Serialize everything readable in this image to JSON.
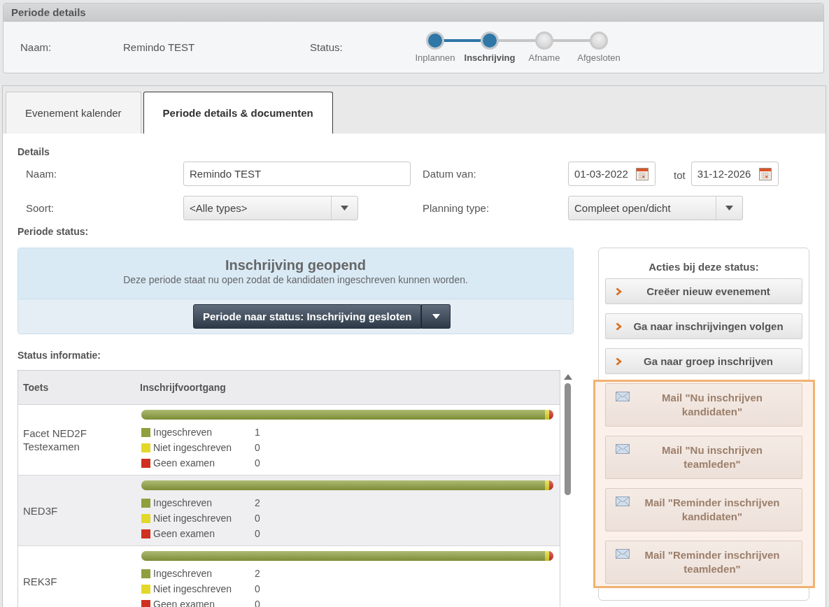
{
  "period_header": {
    "title": "Periode details",
    "name_label": "Naam:",
    "name_value": "Remindo TEST",
    "status_label": "Status:",
    "steps": [
      {
        "label": "Inplannen",
        "completed": true,
        "selected": false
      },
      {
        "label": "Inschrijving",
        "completed": true,
        "selected": true
      },
      {
        "label": "Afname",
        "completed": false,
        "selected": false
      },
      {
        "label": "Afgesloten",
        "completed": false,
        "selected": false
      }
    ]
  },
  "tabs": [
    {
      "label": "Evenement kalender",
      "selected": false
    },
    {
      "label": "Periode details & documenten",
      "selected": true
    }
  ],
  "details": {
    "title": "Details",
    "fields": [
      {
        "label": "Naam:",
        "kind": "text",
        "value": "Remindo TEST"
      },
      {
        "label": "Datum van:",
        "kind": "date_range",
        "from": "01-03-2022",
        "separator": "tot",
        "to": "31-12-2026"
      },
      {
        "label": "Soort:",
        "kind": "select",
        "value": "<Alle types>"
      },
      {
        "label": "Planning type:",
        "kind": "select",
        "value": "Compleet open/dicht"
      }
    ]
  },
  "period_status": {
    "title": "Periode status:",
    "status_box": {
      "title": "Inschrijving geopend",
      "description": "Deze periode staat nu open zodat de kandidaten ingeschreven kunnen worden.",
      "action_button": "Periode naar status: Inschrijving gesloten"
    }
  },
  "status_info": {
    "title": "Status informatie:",
    "columns": [
      "Toets",
      "Inschrijfvoortgang"
    ],
    "rows": [
      {
        "toets": "Facet NED2F Testexamen",
        "progress": [
          {
            "label": "Ingeschreven",
            "count": "1",
            "color": "#8ea03e",
            "level": 0.98
          },
          {
            "label": "Niet ingeschreven",
            "count": "0",
            "color": "#e3d82a",
            "level": 0.01
          },
          {
            "label": "Geen examen",
            "count": "0",
            "color": "#cf3020",
            "level": 0.01
          }
        ]
      },
      {
        "toets": "NED3F",
        "progress": [
          {
            "label": "Ingeschreven",
            "count": "2",
            "color": "#8ea03e",
            "level": 0.98
          },
          {
            "label": "Niet ingeschreven",
            "count": "0",
            "color": "#e3d82a",
            "level": 0.01
          },
          {
            "label": "Geen examen",
            "count": "0",
            "color": "#cf3020",
            "level": 0.01
          }
        ]
      },
      {
        "toets": "REK3F",
        "progress": [
          {
            "label": "Ingeschreven",
            "count": "2",
            "color": "#8ea03e",
            "level": 0.98
          },
          {
            "label": "Niet ingeschreven",
            "count": "0",
            "color": "#e3d82a",
            "level": 0.01
          },
          {
            "label": "Geen examen",
            "count": "0",
            "color": "#cf3020",
            "level": 0.01
          }
        ]
      }
    ]
  },
  "actions": {
    "title": "Acties bij deze status:",
    "buttons": [
      {
        "label": "Creëer nieuw evenement",
        "kind": "navigate"
      },
      {
        "label": "Ga naar inschrijvingen volgen",
        "kind": "navigate"
      },
      {
        "label": "Ga naar groep inschrijven",
        "kind": "navigate"
      }
    ],
    "highlighted_buttons": [
      {
        "label": "Mail \"Nu inschrijven kandidaten\"",
        "kind": "mail"
      },
      {
        "label": "Mail \"Nu inschrijven teamleden\"",
        "kind": "mail"
      },
      {
        "label": "Mail \"Reminder inschrijven kandidaten\"",
        "kind": "mail"
      },
      {
        "label": "Mail \"Reminder inschrijven teamleden\"",
        "kind": "mail"
      }
    ]
  }
}
